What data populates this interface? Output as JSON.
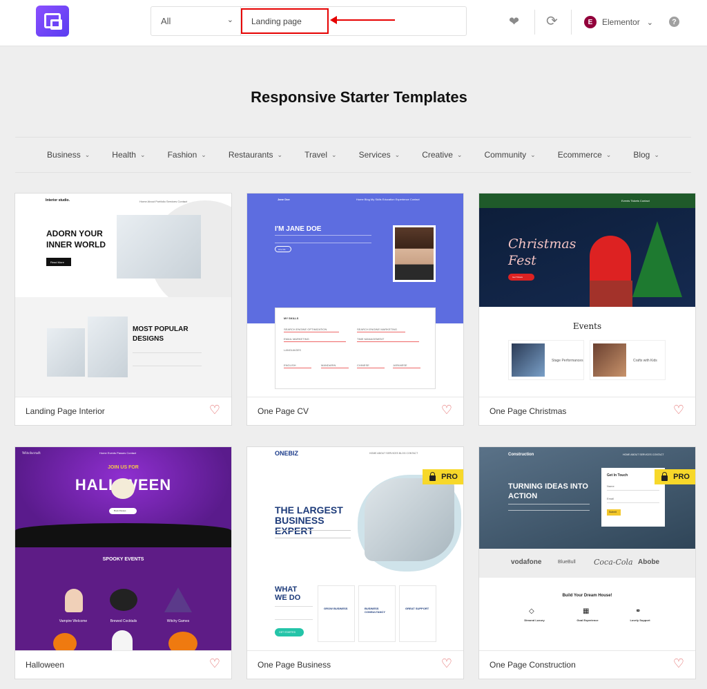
{
  "header": {
    "category": "All",
    "search_value": "Landing page",
    "builder": "Elementor",
    "builder_badge": "E",
    "help": "?"
  },
  "page_title": "Responsive Starter Templates",
  "categories": [
    "Business",
    "Health",
    "Fashion",
    "Restaurants",
    "Travel",
    "Services",
    "Creative",
    "Community",
    "Ecommerce",
    "Blog"
  ],
  "templates": [
    {
      "name": "Landing Page Interior",
      "pro": false
    },
    {
      "name": "One Page CV",
      "pro": false
    },
    {
      "name": "One Page Christmas",
      "pro": false
    },
    {
      "name": "Halloween",
      "pro": false
    },
    {
      "name": "One Page Business",
      "pro": true
    },
    {
      "name": "One Page Construction",
      "pro": true
    }
  ],
  "pro_label": "PRO",
  "previews": {
    "interior": {
      "brand": "Interior studio.",
      "nav": "Home   About   Portfolio   Services   Contact",
      "hero": "ADORN YOUR INNER WORLD",
      "btn": "Read More",
      "section": "MOST POPULAR DESIGNS"
    },
    "cv": {
      "brand": "Jane Doe",
      "nav": "Home   Blog   My Skills   Education   Experience   Contact",
      "hero": "I'M JANE DOE",
      "btn": "Hire Me",
      "skills": "MY SKILLS",
      "skill1": "SEARCH ENGINE OPTIMIZATION",
      "skill2": "SEARCH ENGINE MARKETING",
      "skill3": "EMAIL MARKETING",
      "skill4": "TIME MANAGEMENT",
      "langs": "LANGUAGES",
      "lang1": "ENGLISH",
      "lang2": "MANDARIN",
      "lang3": "CHINESE",
      "lang4": "JAPANESE"
    },
    "christmas": {
      "nav": "Events   Tickets   Contact",
      "hero": "Christmas Fest",
      "btn": "Get Tickets",
      "section": "Events",
      "event1": "Stage Performances",
      "event2": "Crafts with Kids"
    },
    "halloween": {
      "brand": "Witchcraft",
      "nav": "Home   Events   Passes   Contact",
      "join": "JOIN US FOR",
      "hero": "HALL  WEEN",
      "btn": "Book Passes",
      "section": "SPOOKY EVENTS",
      "event1": "Vampire Welcome",
      "event2": "Brewed Cocktails",
      "event3": "Witchy Games"
    },
    "business": {
      "brand": "ONEBIZ",
      "nav": "HOME   ABOUT   SERVICES   BLOG   CONTACT",
      "hero": "THE LARGEST BUSINESS EXPERT",
      "section": "WHAT WE DO",
      "svc1": "GROW BUSINESS",
      "svc2": "BUSINESS CONSULTANCY",
      "svc3": "GREAT SUPPORT",
      "btn": "GET STARTED"
    },
    "construction": {
      "brand": "Construction",
      "nav": "HOME   ABOUT   SERVICES   CONTACT",
      "hero": "TURNING IDEAS INTO ACTION",
      "form_title": "Get In Touch",
      "form_name": "Name",
      "form_email": "Email",
      "form_btn": "Submit",
      "logo1": "vodafone",
      "logo2": "BlueBull",
      "logo3": "Coca-Cola",
      "logo4": "Abobe",
      "section": "Build Your Dream House!",
      "feat1": "Dimond Luxury",
      "feat2": "Goal Experience",
      "feat3": "Lovely Support"
    }
  }
}
